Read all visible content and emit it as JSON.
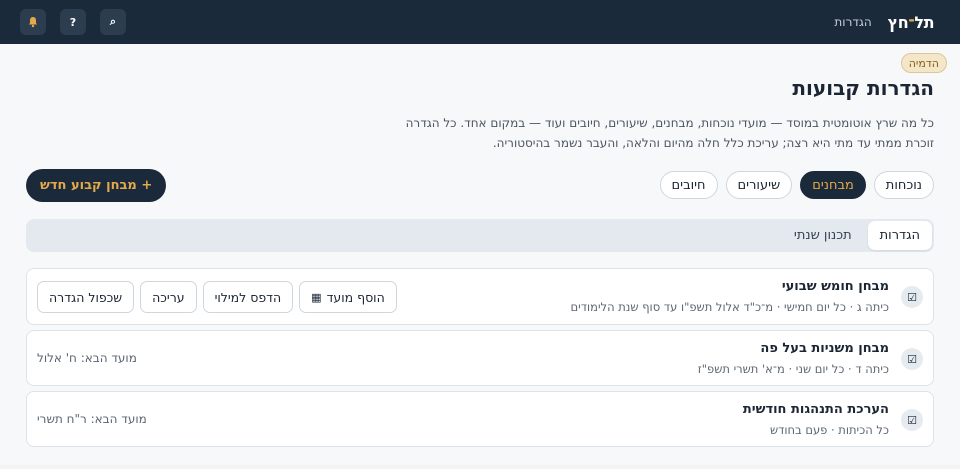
{
  "topbar": {
    "logo_main": "תל",
    "logo_dash": "־",
    "logo_end": "חץ",
    "nav_settings": "הגדרות",
    "icons": {
      "bell": "bell-icon",
      "help": "?",
      "search": "⌕"
    }
  },
  "badge": "הדמיה",
  "page": {
    "title": "הגדרות קבועות",
    "description": "כל מה שרץ אוטומטית במוסד — מועדי נוכחות, מבחנים, שיעורים, חיובים ועוד — במקום אחד. כל הגדרה זוכרת ממתי עד מתי היא רצה; עריכת כלל חלה מהיום והלאה, והעבר נשמר בהיסטוריה."
  },
  "category_tabs": [
    "נוכחות",
    "מבחנים",
    "שיעורים",
    "חיובים"
  ],
  "active_category": "מבחנים",
  "new_button": "+ מבחן קבוע חדש",
  "sub_tabs": {
    "settings": "הגדרות",
    "annual": "תכנון שנתי"
  },
  "rules": [
    {
      "title": "מבחן חומש שבועי",
      "meta": "כיתה ג · כל יום חמישי · מ־כ\"ד אלול תשפ\"ו עד סוף שנת הלימודים",
      "actions": {
        "add_date": "הוסף מועד",
        "print": "הדפס למילוי",
        "edit": "עריכה",
        "duplicate": "שכפול הגדרה"
      }
    },
    {
      "title": "מבחן משניות בעל פה",
      "meta": "כיתה ד · כל יום שני · מ־א' תשרי תשפ\"ז",
      "next": "מועד הבא: ח' אלול"
    },
    {
      "title": "הערכת התנהגות חודשית",
      "meta": "כל הכיתות · פעם בחודש",
      "next": "מועד הבא: ר\"ח תשרי"
    }
  ],
  "colors": {
    "navy": "#1b2a3a",
    "accent": "#e4a94a",
    "badge_bg": "#f4e6c8"
  }
}
